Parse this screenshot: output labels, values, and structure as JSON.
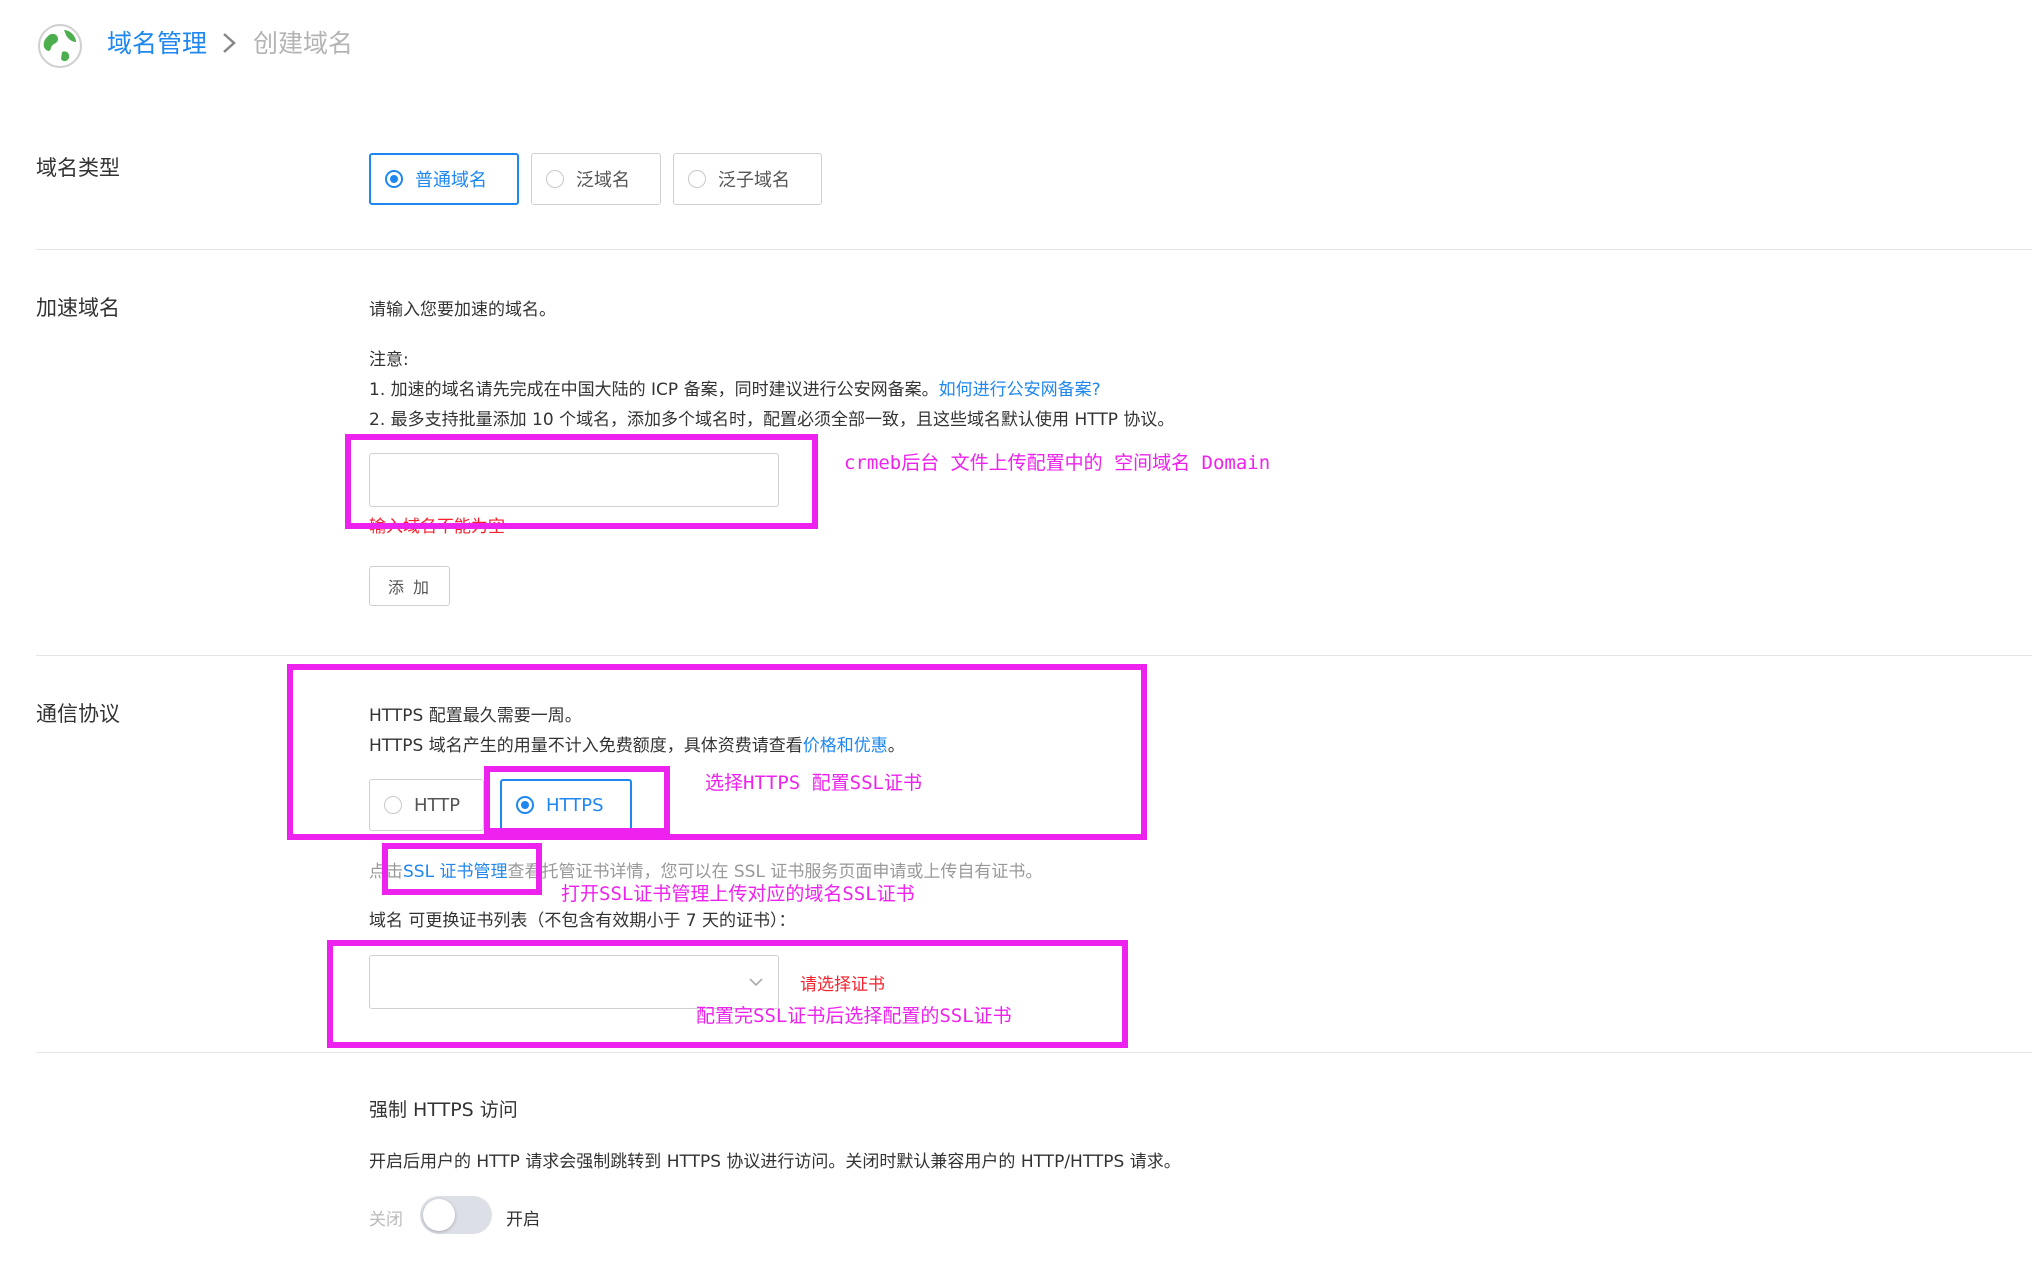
{
  "breadcrumb": {
    "root": "域名管理",
    "current": "创建域名"
  },
  "domain_type": {
    "label": "域名类型",
    "options": [
      "普通域名",
      "泛域名",
      "泛子域名"
    ],
    "selected": "普通域名"
  },
  "accel_domain": {
    "label": "加速域名",
    "intro": "请输入您要加速的域名。",
    "note_title": "注意:",
    "note1": "1. 加速的域名请先完成在中国大陆的 ICP 备案，同时建议进行公安网备案。",
    "note1_link": "如何进行公安网备案?",
    "note2": "2. 最多支持批量添加 10 个域名，添加多个域名时，配置必须全部一致，且这些域名默认使用 HTTP 协议。",
    "input_value": "",
    "error": "输入域名不能为空",
    "add_button": "添 加",
    "annotation": "crmeb后台 文件上传配置中的 空间域名 Domain"
  },
  "protocol": {
    "label": "通信协议",
    "line1": "HTTPS 配置最久需要一周。",
    "line2": "HTTPS 域名产生的用量不计入免费额度，具体资费请查看",
    "line2_link": "价格和优惠",
    "line2_end": "。",
    "options": [
      "HTTP",
      "HTTPS"
    ],
    "selected": "HTTPS",
    "annotation_https": "选择HTTPS  配置SSL证书",
    "ssl_prefix": "点击",
    "ssl_link": "SSL 证书管理",
    "ssl_suffix": "查看托管证书详情，您可以在 SSL 证书服务页面申请或上传自有证书。",
    "annotation_ssl": "打开SSL证书管理上传对应的域名SSL证书",
    "cert_list_label": "域名 可更换证书列表（不包含有效期小于 7 天的证书）：",
    "cert_select_value": "",
    "cert_error": "请选择证书",
    "annotation_cert": "配置完SSL证书后选择配置的SSL证书"
  },
  "force_https": {
    "title": "强制 HTTPS 访问",
    "desc": "开启后用户的 HTTP 请求会强制跳转到 HTTPS 协议进行访问。关闭时默认兼容用户的 HTTP/HTTPS 请求。",
    "off_label": "关闭",
    "on_label": "开启",
    "enabled": false
  },
  "colors": {
    "accent": "#1e87f0",
    "annotation": "#ee22ee",
    "error": "#f5222d"
  },
  "icons": {
    "logo": "globe-logo-icon",
    "separator": "chevron-right-icon",
    "select": "chevron-down-icon"
  }
}
